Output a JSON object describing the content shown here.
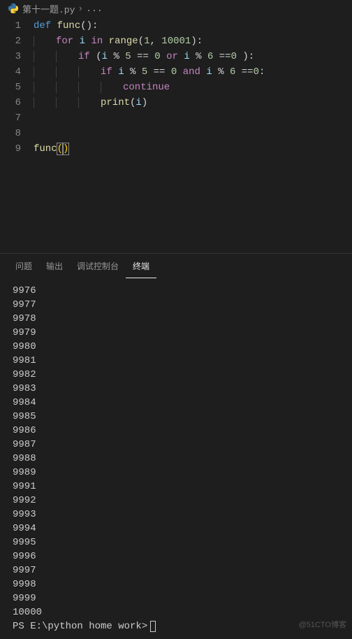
{
  "breadcrumb": {
    "filename": "第十一题.py",
    "separator": "›",
    "more": "..."
  },
  "editor": {
    "line_numbers": [
      "1",
      "2",
      "3",
      "4",
      "5",
      "6",
      "7",
      "8",
      "9"
    ],
    "tokens": {
      "def": "def",
      "func_name": "func",
      "for": "for",
      "i": "i",
      "in": "in",
      "range": "range",
      "r1": "1",
      "r2": "10001",
      "if": "if",
      "mod": "%",
      "n5": "5",
      "n6": "6",
      "n0": "0",
      "eq": "==",
      "or": "or",
      "and": "and",
      "continue": "continue",
      "print": "print",
      "call_func": "func"
    }
  },
  "panel": {
    "tabs": {
      "problems": "问题",
      "output": "输出",
      "debug": "调试控制台",
      "terminal": "终端"
    },
    "terminal_output": [
      "9976",
      "9977",
      "9978",
      "9979",
      "9980",
      "9981",
      "9982",
      "9983",
      "9984",
      "9985",
      "9986",
      "9987",
      "9988",
      "9989",
      "9991",
      "9992",
      "9993",
      "9994",
      "9995",
      "9996",
      "9997",
      "9998",
      "9999",
      "10000"
    ],
    "prompt": "PS E:\\python home work> "
  },
  "watermark": "@51CTO博客"
}
